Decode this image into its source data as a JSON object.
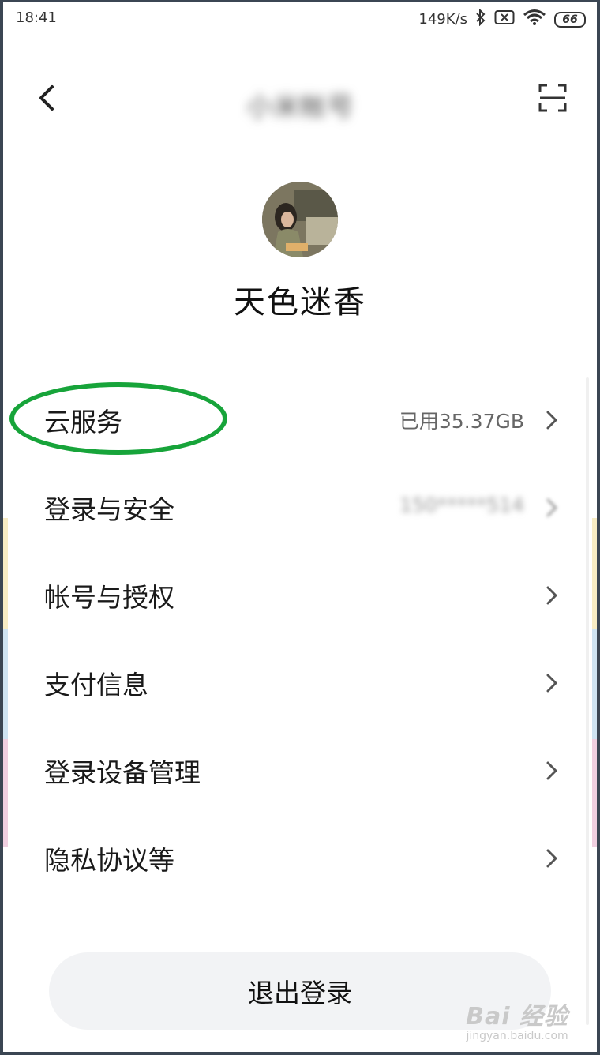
{
  "status_bar": {
    "time": "18:41",
    "net_speed": "149K/s",
    "battery": "66"
  },
  "header": {
    "title": "小米帐号"
  },
  "profile": {
    "username": "天色迷香"
  },
  "menu": {
    "items": [
      {
        "label": "云服务",
        "value": "已用35.37GB"
      },
      {
        "label": "登录与安全",
        "value": "150*****514"
      },
      {
        "label": "帐号与授权",
        "value": ""
      },
      {
        "label": "支付信息",
        "value": ""
      },
      {
        "label": "登录设备管理",
        "value": ""
      },
      {
        "label": "隐私协议等",
        "value": ""
      }
    ]
  },
  "logout": {
    "label": "退出登录"
  },
  "watermark": {
    "main": "Bai 经验",
    "sub": "jingyan.baidu.com"
  },
  "colors": {
    "highlight": "#17a43a",
    "button_bg": "#f2f3f5",
    "text_primary": "#1a1a1a",
    "text_secondary": "#666666"
  }
}
